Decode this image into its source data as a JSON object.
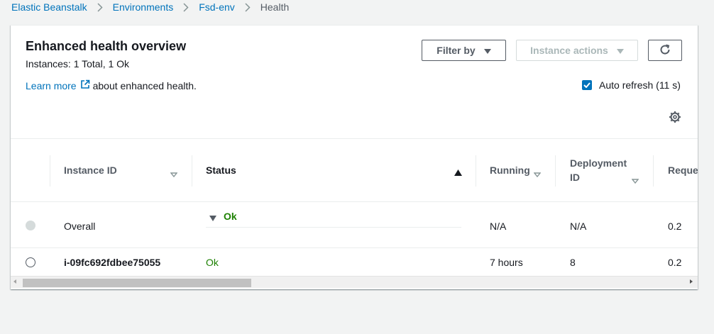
{
  "breadcrumb": {
    "items": [
      "Elastic Beanstalk",
      "Environments",
      "Fsd-env"
    ],
    "current": "Health"
  },
  "panel": {
    "title": "Enhanced health overview",
    "subtitle": "Instances: 1 Total, 1 Ok",
    "learn_more": "Learn more",
    "learn_more_suffix": "about enhanced health.",
    "filter_label": "Filter by",
    "actions_label": "Instance actions",
    "auto_refresh_label": "Auto refresh (11 s)",
    "auto_refresh_checked": true
  },
  "table": {
    "columns": [
      "Instance ID",
      "Status",
      "Running",
      "Deployment ID",
      "Reque"
    ],
    "deployment_line1": "Deployment",
    "deployment_line2": "ID",
    "rows": [
      {
        "instance": "Overall",
        "status": "Ok",
        "running": "N/A",
        "deployment": "N/A",
        "requests": "0.2"
      },
      {
        "instance": "i-09fc692fdbee75055",
        "status": "Ok",
        "running": "7 hours",
        "deployment": "8",
        "requests": "0.2"
      }
    ]
  },
  "colors": {
    "link": "#0073bb",
    "ok": "#1d8102",
    "border": "#eaeded"
  }
}
